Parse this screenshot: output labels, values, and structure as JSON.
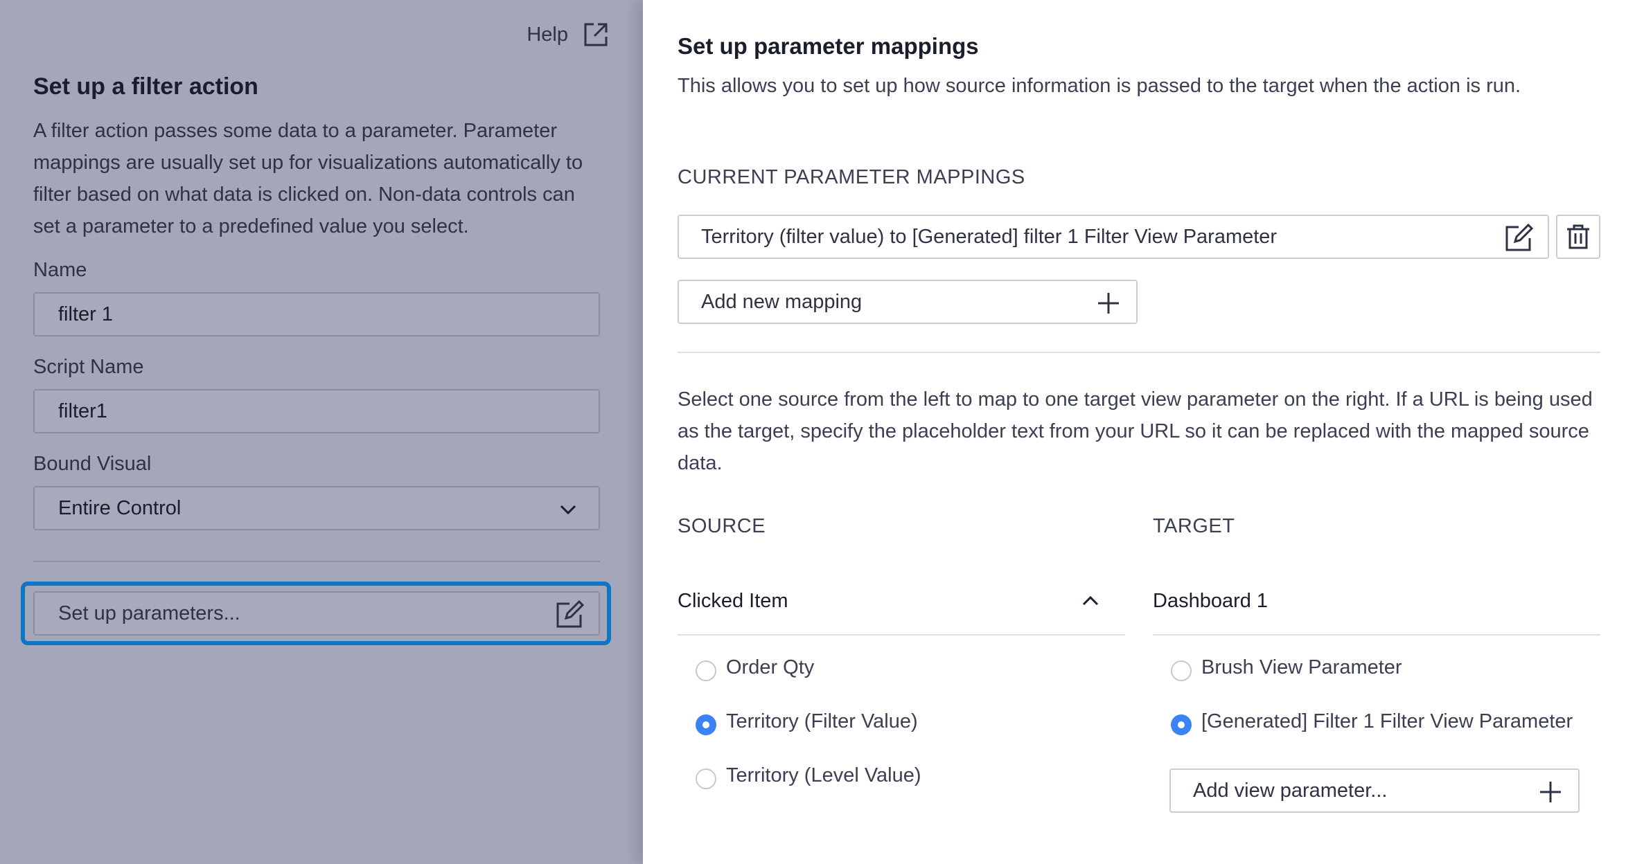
{
  "left_panel": {
    "help_label": "Help",
    "title": "Set up a filter action",
    "description": "A filter action passes some data to a parameter. Parameter mappings are usually set up for visualizations automatically to filter based on what data is clicked on. Non-data controls can set a parameter to a predefined value you select.",
    "name_label": "Name",
    "name_value": "filter 1",
    "script_name_label": "Script Name",
    "script_name_value": "filter1",
    "bound_visual_label": "Bound Visual",
    "bound_visual_value": "Entire Control",
    "setup_parameters_label": "Set up parameters..."
  },
  "right_panel": {
    "title": "Set up parameter mappings",
    "subtitle": "This allows you to set up how source information is passed to the target when the action is run.",
    "current_mappings_label": "CURRENT PARAMETER MAPPINGS",
    "mappings": [
      {
        "label": "Territory (filter value) to [Generated] filter 1 Filter View Parameter"
      }
    ],
    "add_mapping_label": "Add new mapping",
    "instructions": "Select one source from the left to map to one target view parameter on the right. If a URL is being used as the target, specify the placeholder text from your URL so it can be replaced with the mapped source data.",
    "source": {
      "heading": "SOURCE",
      "group": "Clicked Item",
      "options": [
        {
          "label": "Order Qty",
          "selected": false
        },
        {
          "label": "Territory (Filter Value)",
          "selected": true
        },
        {
          "label": "Territory (Level Value)",
          "selected": false
        }
      ]
    },
    "target": {
      "heading": "TARGET",
      "group": "Dashboard 1",
      "options": [
        {
          "label": "Brush View Parameter",
          "selected": false
        },
        {
          "label": "[Generated] Filter 1 Filter View Parameter",
          "selected": true
        }
      ],
      "add_view_parameter_label": "Add view parameter..."
    }
  },
  "colors": {
    "left_background": "#a4a6b9",
    "focus_ring": "#0b76c6",
    "radio_selected": "#3b82f6"
  },
  "icons": {
    "help": "external-link-icon",
    "edit": "edit-icon",
    "delete": "trash-icon",
    "add": "plus-icon",
    "dropdown": "chevron-down-icon",
    "collapse": "chevron-up-icon"
  }
}
